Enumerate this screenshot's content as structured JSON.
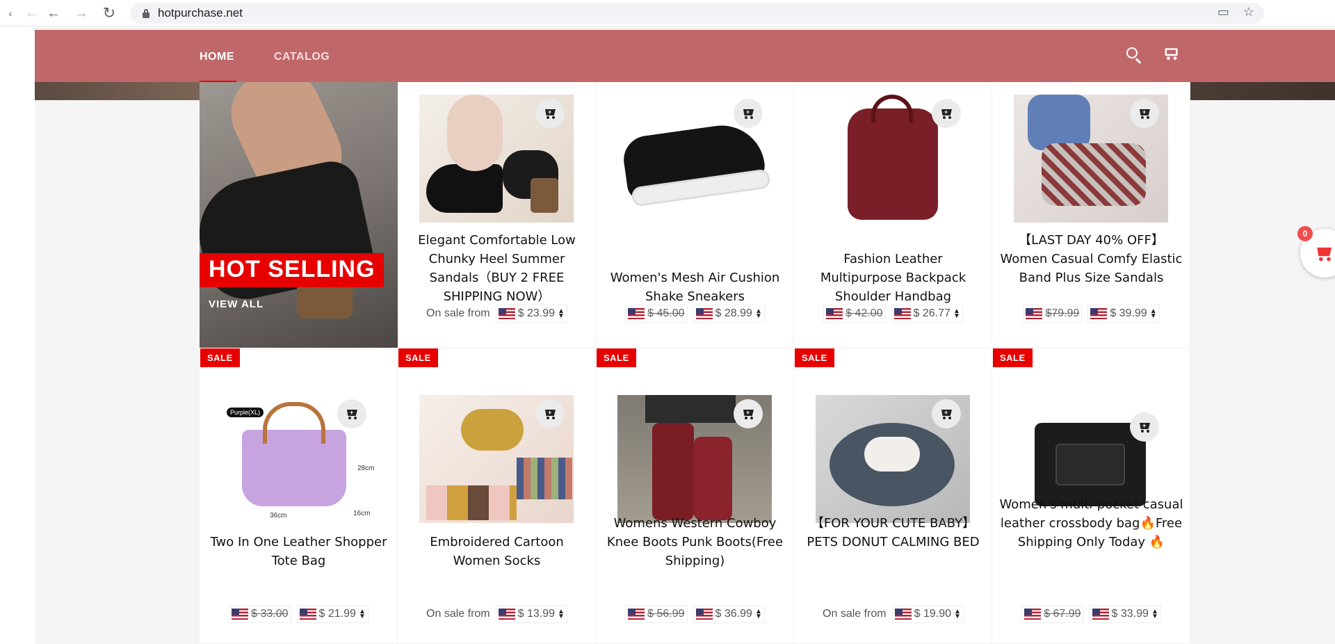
{
  "browser": {
    "url": "hotpurchase.net"
  },
  "nav": {
    "home": "HOME",
    "catalog": "CATALOG"
  },
  "hero": {
    "badge": "HOT SELLING",
    "link": "VIEW ALL"
  },
  "colors": {
    "nav_bg": "#c0676a",
    "sale_red": "#e60000"
  },
  "floating_cart": {
    "count": "0"
  },
  "products": [
    {
      "title": "Elegant Comfortable Low Chunky Heel Summer Sandals（BUY 2 FREE SHIPPING NOW）",
      "on_sale_from": "On sale from",
      "price": "$ 23.99",
      "sale": false
    },
    {
      "title": "Women's Mesh Air Cushion Shake Sneakers",
      "old_price": "$ 45.00",
      "price": "$ 28.99",
      "sale": false
    },
    {
      "title": "Fashion Leather Multipurpose Backpack Shoulder Handbag",
      "old_price": "$ 42.00",
      "price": "$ 26.77",
      "sale": false
    },
    {
      "title": "【LAST DAY 40% OFF】Women Casual Comfy Elastic Band Plus Size Sandals",
      "old_price": "$79.99",
      "price": "$ 39.99",
      "sale": false
    },
    {
      "title": "Two In One Leather Shopper Tote Bag",
      "old_price": "$ 33.00",
      "price": "$ 21.99",
      "sale": true,
      "sale_label": "SALE"
    },
    {
      "title": "Embroidered Cartoon Women Socks",
      "on_sale_from": "On sale from",
      "price": "$ 13.99",
      "sale": true,
      "sale_label": "SALE"
    },
    {
      "title": "Womens Western Cowboy Knee Boots Punk Boots(Free Shipping)",
      "old_price": "$ 56.99",
      "price": "$ 36.99",
      "sale": true,
      "sale_label": "SALE"
    },
    {
      "title": "【FOR YOUR CUTE BABY】PETS DONUT CALMING BED",
      "on_sale_from": "On sale from",
      "price": "$ 19.90",
      "sale": true,
      "sale_label": "SALE"
    },
    {
      "title": "Women's multi-pocket casual leather crossbody bag🔥Free Shipping Only Today 🔥",
      "old_price": "$ 67.99",
      "price": "$ 33.99",
      "sale": true,
      "sale_label": "SALE"
    }
  ]
}
